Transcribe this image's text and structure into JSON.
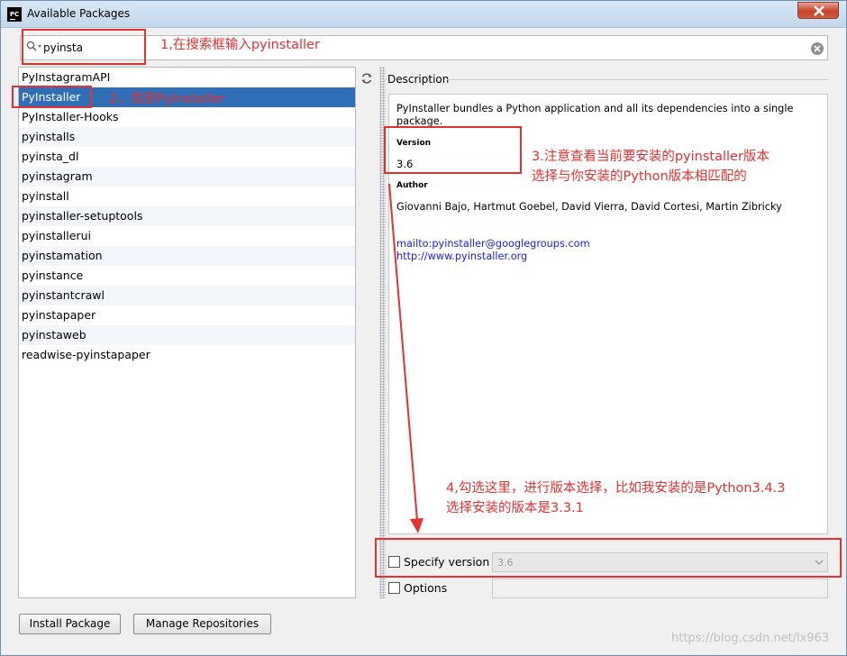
{
  "window": {
    "title": "Available Packages",
    "logo_text": "PC"
  },
  "search": {
    "value": "pyinsta"
  },
  "packages": [
    "PyInstagramAPI",
    "PyInstaller",
    "PyInstaller-Hooks",
    "pyinstalls",
    "pyinsta_dl",
    "pyinstagram",
    "pyinstall",
    "pyinstaller-setuptools",
    "pyinstallerui",
    "pyinstamation",
    "pyinstance",
    "pyinstantcrawl",
    "pyinstapaper",
    "pyinstaweb",
    "readwise-pyinstapaper"
  ],
  "selected_package": "PyInstaller",
  "description": {
    "section_title": "Description",
    "text": "PyInstaller bundles a Python application and all its dependencies into a single package.",
    "version_label": "Version",
    "version_value": "3.6",
    "author_label": "Author",
    "author_value": "Giovanni Bajo, Hartmut Goebel, David Vierra, David Cortesi, Martin Zibricky",
    "link_email": "mailto:pyinstaller@googlegroups.com",
    "link_web": "http://www.pyinstaller.org"
  },
  "options": {
    "specify_version_label": "Specify version",
    "specify_version_checked": false,
    "version_select_value": "3.6",
    "options_label": "Options",
    "options_checked": false,
    "options_value": ""
  },
  "buttons": {
    "install": "Install Package",
    "manage": "Manage Repositories"
  },
  "annotations": {
    "step1": "1,在搜索框输入pyinstaller",
    "step2": "2，找到PyInstaller",
    "step3_line1": "3.注意查看当前要安装的pyinstaller版本",
    "step3_line2": "选择与你安装的Python版本相匹配的",
    "step4_line1": "4,勾选这里，进行版本选择，比如我安装的是Python3.4.3",
    "step4_line2": "选择安装的版本是3.3.1",
    "color": "#e53030"
  },
  "watermark": "https://blog.csdn.net/lx963"
}
